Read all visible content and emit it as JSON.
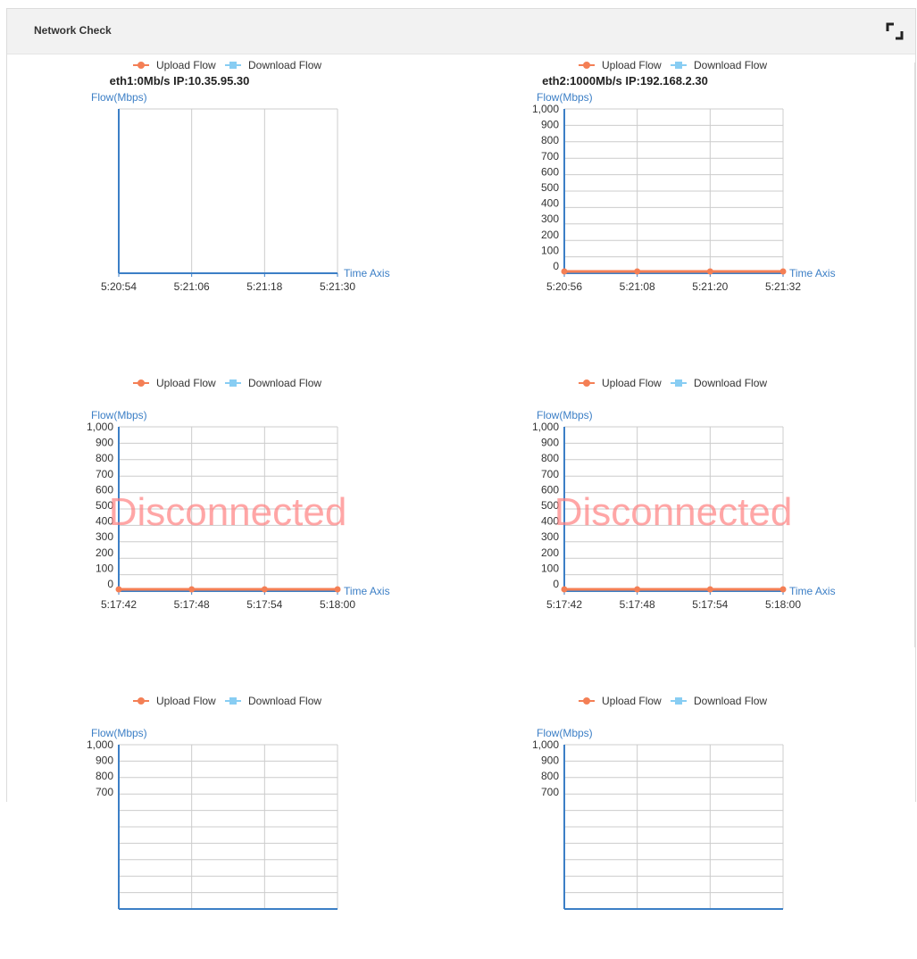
{
  "panel": {
    "title": "Network Check",
    "expand_icon": "expand-corners-icon"
  },
  "colors": {
    "upload": "#f47f55",
    "download": "#88cdf3",
    "axis": "#3c7fc6",
    "grid": "#cccccc",
    "disconnected": "#ff8080"
  },
  "legend": {
    "upload": "Upload Flow",
    "download": "Download Flow"
  },
  "chart_data": [
    {
      "type": "line",
      "title": "eth1:0Mb/s IP:10.35.95.30",
      "ylabel": "Flow(Mbps)",
      "xlabel": "Time Axis",
      "x": [
        "5:20:54",
        "5:21:06",
        "5:21:18",
        "5:21:30"
      ],
      "yticks": [],
      "ylim": [
        0,
        0
      ],
      "series": [
        {
          "name": "Upload Flow",
          "values": []
        },
        {
          "name": "Download Flow",
          "values": []
        }
      ],
      "status": ""
    },
    {
      "type": "line",
      "title": "eth2:1000Mb/s IP:192.168.2.30",
      "ylabel": "Flow(Mbps)",
      "xlabel": "Time Axis",
      "x": [
        "5:20:56",
        "5:21:08",
        "5:21:20",
        "5:21:32"
      ],
      "yticks": [
        "0",
        "100",
        "200",
        "300",
        "400",
        "500",
        "600",
        "700",
        "800",
        "900",
        "1,000"
      ],
      "ylim": [
        0,
        1000
      ],
      "series": [
        {
          "name": "Upload Flow",
          "values": [
            0,
            0,
            0,
            0
          ]
        },
        {
          "name": "Download Flow",
          "values": [
            0,
            0,
            0,
            0
          ]
        }
      ],
      "status": ""
    },
    {
      "type": "line",
      "title": "",
      "ylabel": "Flow(Mbps)",
      "xlabel": "Time Axis",
      "x": [
        "5:17:42",
        "5:17:48",
        "5:17:54",
        "5:18:00"
      ],
      "yticks": [
        "0",
        "100",
        "200",
        "300",
        "400",
        "500",
        "600",
        "700",
        "800",
        "900",
        "1,000"
      ],
      "ylim": [
        0,
        1000
      ],
      "series": [
        {
          "name": "Upload Flow",
          "values": [
            0,
            0,
            0,
            0
          ]
        },
        {
          "name": "Download Flow",
          "values": [
            0,
            0,
            0,
            0
          ]
        }
      ],
      "status": "Disconnected"
    },
    {
      "type": "line",
      "title": "",
      "ylabel": "Flow(Mbps)",
      "xlabel": "Time Axis",
      "x": [
        "5:17:42",
        "5:17:48",
        "5:17:54",
        "5:18:00"
      ],
      "yticks": [
        "0",
        "100",
        "200",
        "300",
        "400",
        "500",
        "600",
        "700",
        "800",
        "900",
        "1,000"
      ],
      "ylim": [
        0,
        1000
      ],
      "series": [
        {
          "name": "Upload Flow",
          "values": [
            0,
            0,
            0,
            0
          ]
        },
        {
          "name": "Download Flow",
          "values": [
            0,
            0,
            0,
            0
          ]
        }
      ],
      "status": "Disconnected"
    },
    {
      "type": "line",
      "title": "",
      "ylabel": "Flow(Mbps)",
      "xlabel": "",
      "x": [],
      "yticks": [
        "700",
        "800",
        "900",
        "1,000"
      ],
      "ylim": [
        0,
        1000
      ],
      "series": [
        {
          "name": "Upload Flow",
          "values": []
        },
        {
          "name": "Download Flow",
          "values": []
        }
      ],
      "status": ""
    },
    {
      "type": "line",
      "title": "",
      "ylabel": "Flow(Mbps)",
      "xlabel": "",
      "x": [],
      "yticks": [
        "700",
        "800",
        "900",
        "1,000"
      ],
      "ylim": [
        0,
        1000
      ],
      "series": [
        {
          "name": "Upload Flow",
          "values": []
        },
        {
          "name": "Download Flow",
          "values": []
        }
      ],
      "status": ""
    }
  ]
}
